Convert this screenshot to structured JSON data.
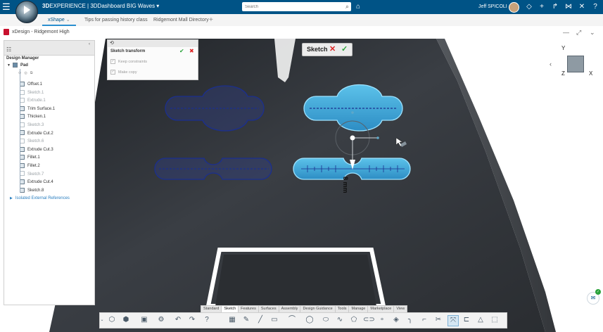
{
  "topbar": {
    "brand_prefix": "3D",
    "brand_main": "EXPERIENCE | 3DDashboard  BIG Waves",
    "search_placeholder": "Search",
    "user_name": "Jeff SPICOLI"
  },
  "tabs": [
    {
      "label": "xShape"
    },
    {
      "label": "Tips for passing history class"
    },
    {
      "label": "Ridgemont Mall Directory"
    }
  ],
  "document": {
    "title": "xDesign - Ridgemont High"
  },
  "tree": {
    "title": "Design Manager",
    "root": "Pad",
    "items": [
      {
        "label": "Offset.1",
        "state": "active"
      },
      {
        "label": "Sketch.1",
        "state": "dim"
      },
      {
        "label": "Extrude.1",
        "state": "dim"
      },
      {
        "label": "Trim Surface.1",
        "state": "active"
      },
      {
        "label": "Thicken.1",
        "state": "active"
      },
      {
        "label": "Sketch.3",
        "state": "dim"
      },
      {
        "label": "Extrude Cut.2",
        "state": "active"
      },
      {
        "label": "Sketch.6",
        "state": "dim"
      },
      {
        "label": "Extrude Cut.3",
        "state": "active"
      },
      {
        "label": "Fillet.1",
        "state": "active"
      },
      {
        "label": "Fillet.2",
        "state": "active"
      },
      {
        "label": "Sketch.7",
        "state": "dim"
      },
      {
        "label": "Extrude Cut.4",
        "state": "active"
      },
      {
        "label": "Sketch.8",
        "state": "active"
      }
    ],
    "footer": "Isolated External References"
  },
  "sketch_transform": {
    "title": "Sketch transform",
    "options": [
      {
        "label": "Keep constraints",
        "checked": true
      },
      {
        "label": "Make copy",
        "checked": true
      }
    ]
  },
  "sketch_badge": {
    "label": "Sketch"
  },
  "dimension": {
    "value": "8 mm"
  },
  "orientation": {
    "y": "Y",
    "x": "X",
    "z": "Z"
  },
  "bottom_tabs": [
    {
      "label": "Standard",
      "active": false
    },
    {
      "label": "Sketch",
      "active": true
    },
    {
      "label": "Features",
      "active": false
    },
    {
      "label": "Surfaces",
      "active": false
    },
    {
      "label": "Assembly",
      "active": false
    },
    {
      "label": "Design Guidance",
      "active": false
    },
    {
      "label": "Tools",
      "active": false
    },
    {
      "label": "Manage",
      "active": false
    },
    {
      "label": "Marketplace",
      "active": false
    },
    {
      "label": "View",
      "active": false
    }
  ],
  "colors": {
    "topbar": "#005386",
    "accent": "#2a8fd0",
    "selected_fill": "#3ea8d8",
    "sketch_outline": "#1b2f8f",
    "model_dark": "#2e3237"
  }
}
